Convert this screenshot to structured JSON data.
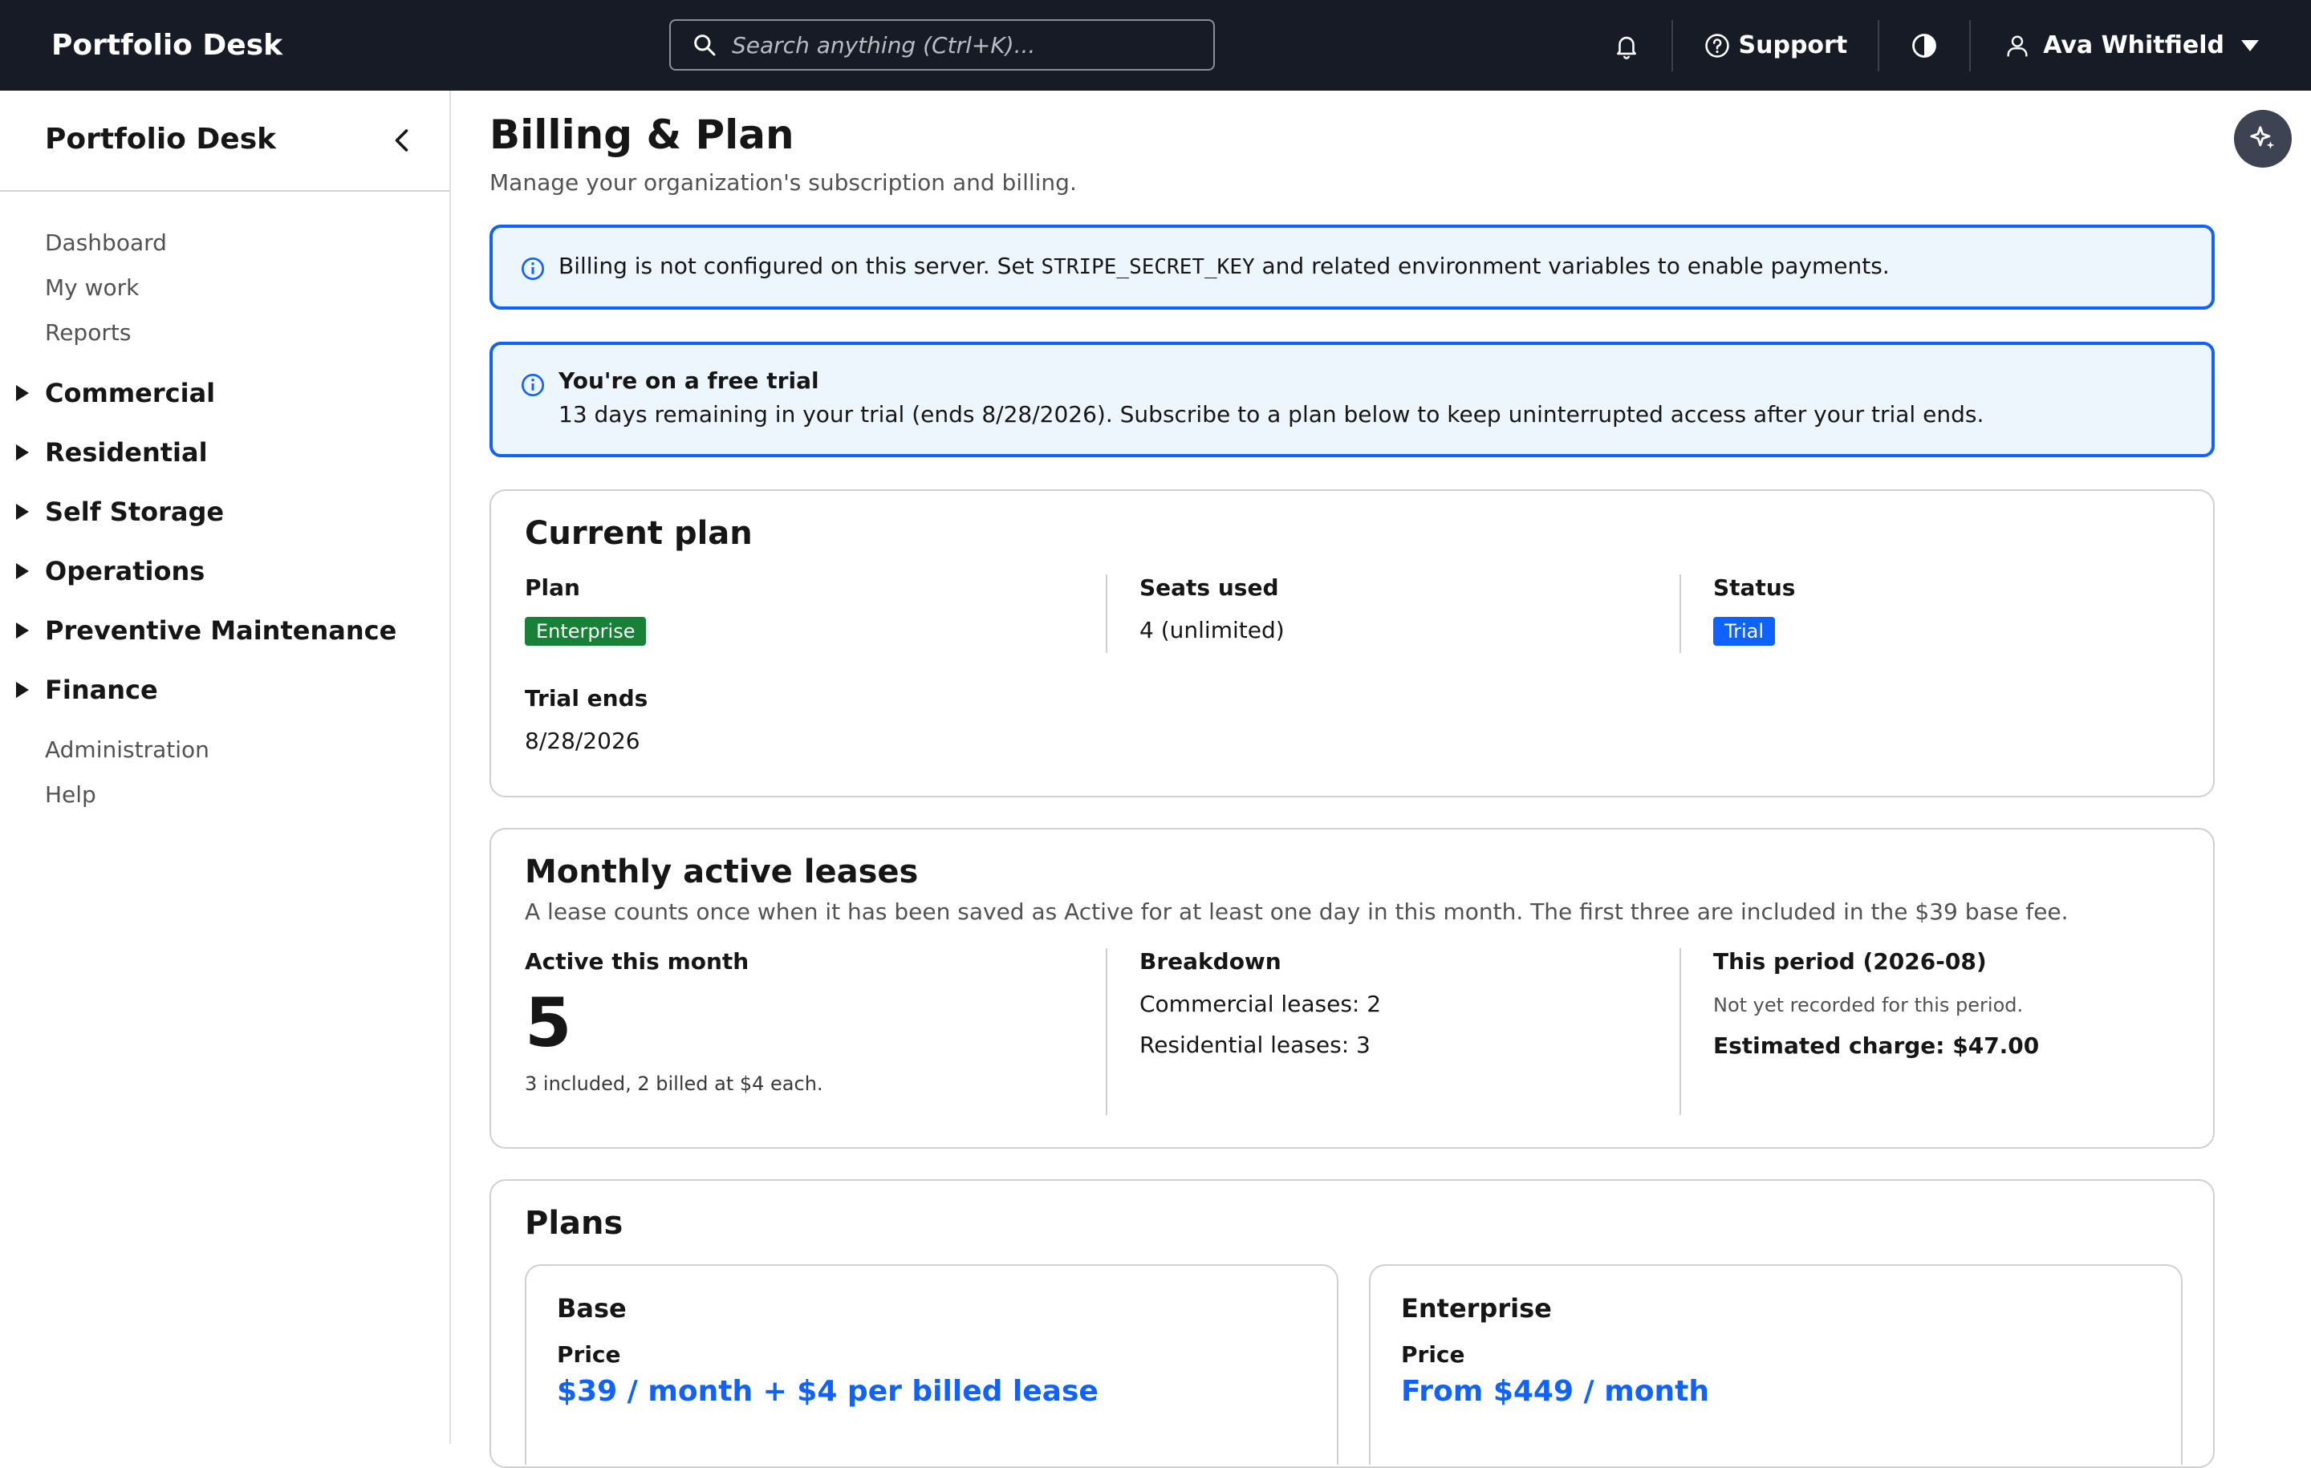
{
  "app": {
    "brand": "Portfolio Desk"
  },
  "search": {
    "placeholder": "Search anything (Ctrl+K)..."
  },
  "topbar": {
    "support": "Support",
    "user": "Ava Whitfield"
  },
  "sidebar": {
    "title": "Portfolio Desk",
    "links_top": [
      "Dashboard",
      "My work",
      "Reports"
    ],
    "groups": [
      "Commercial",
      "Residential",
      "Self Storage",
      "Operations",
      "Preventive Maintenance",
      "Finance"
    ],
    "links_bottom": [
      "Administration",
      "Help"
    ]
  },
  "page": {
    "title": "Billing & Plan",
    "subtitle": "Manage your organization's subscription and billing."
  },
  "notice_billing": {
    "before": "Billing is not configured on this server. Set ",
    "code": "STRIPE_SECRET_KEY",
    "after": " and related environment variables to enable payments."
  },
  "notice_trial": {
    "title": "You're on a free trial",
    "body": "13 days remaining in your trial (ends 8/28/2026). Subscribe to a plan below to keep uninterrupted access after your trial ends."
  },
  "current_plan": {
    "title": "Current plan",
    "plan_label": "Plan",
    "plan_value": "Enterprise",
    "seats_label": "Seats used",
    "seats_value": "4 (unlimited)",
    "status_label": "Status",
    "status_value": "Trial",
    "trial_label": "Trial ends",
    "trial_value": "8/28/2026"
  },
  "leases": {
    "title": "Monthly active leases",
    "description": "A lease counts once when it has been saved as Active for at least one day in this month. The first three are included in the $39 base fee.",
    "active_label": "Active this month",
    "active_value": "5",
    "active_note": "3 included, 2 billed at $4 each.",
    "breakdown_label": "Breakdown",
    "commercial": "Commercial leases: 2",
    "residential": "Residential leases: 3",
    "period_label": "This period (2026-08)",
    "period_note": "Not yet recorded for this period.",
    "estimated": "Estimated charge: $47.00"
  },
  "plans": {
    "title": "Plans",
    "items": [
      {
        "name": "Base",
        "price_label": "Price",
        "price": "$39 / month + $4 per billed lease"
      },
      {
        "name": "Enterprise",
        "price_label": "Price",
        "price": "From $449 / month"
      }
    ]
  },
  "colors": {
    "topbar": "#161b26",
    "accent": "#0f62fe",
    "enterprise_badge": "#198038",
    "trial_badge": "#0f62fe"
  }
}
